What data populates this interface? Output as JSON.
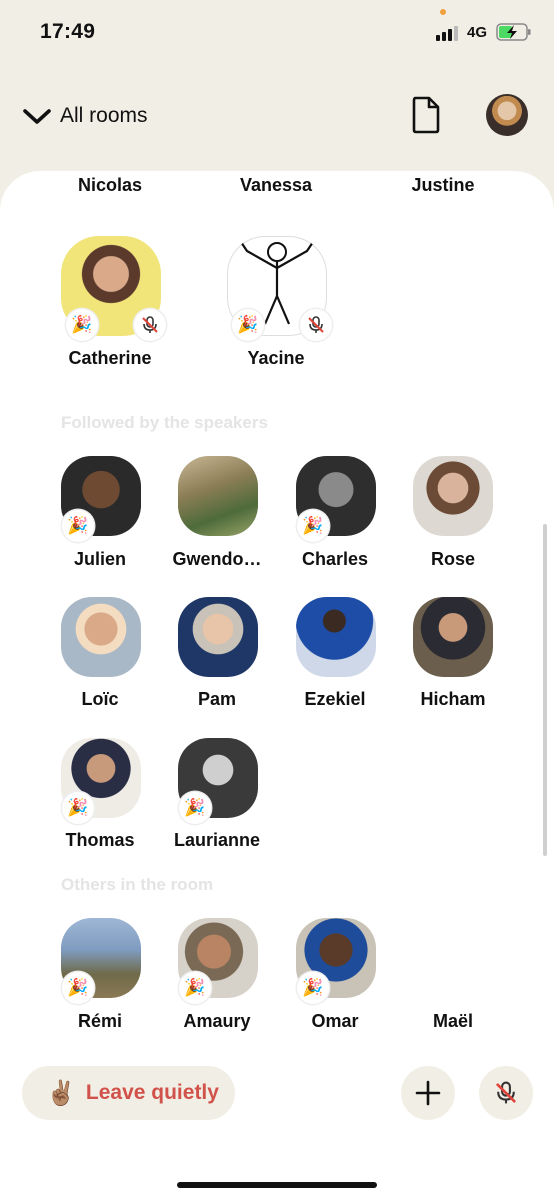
{
  "status_bar": {
    "time": "17:49",
    "network": "4G"
  },
  "header": {
    "back_label": "All rooms"
  },
  "speakers_top_row": [
    "Nicolas",
    "Vanessa",
    "Justine"
  ],
  "speakers": [
    {
      "name": "Catherine"
    },
    {
      "name": "Yacine"
    }
  ],
  "sections": {
    "followed": "Followed by the speakers",
    "others": "Others in the room"
  },
  "followed": [
    {
      "name": "Julien"
    },
    {
      "name": "Gwendo…"
    },
    {
      "name": "Charles"
    },
    {
      "name": "Rose"
    },
    {
      "name": "Loïc"
    },
    {
      "name": "Pam"
    },
    {
      "name": "Ezekiel"
    },
    {
      "name": "Hicham"
    },
    {
      "name": "Thomas"
    },
    {
      "name": "Laurianne"
    }
  ],
  "others": [
    {
      "name": "Rémi"
    },
    {
      "name": "Amaury"
    },
    {
      "name": "Omar"
    },
    {
      "name": "Maël"
    }
  ],
  "bottom": {
    "leave_label": "Leave quietly",
    "peace_emoji": "✌🏽",
    "add_icon": "plus-icon",
    "mic_icon": "mic-muted-icon"
  },
  "badge_emoji": "🎉",
  "colors": {
    "background": "#f1efe5",
    "sheet": "#ffffff",
    "leave_text": "#d1524a",
    "section_text": "#e4e4e4",
    "mute_red": "#e0453a"
  }
}
